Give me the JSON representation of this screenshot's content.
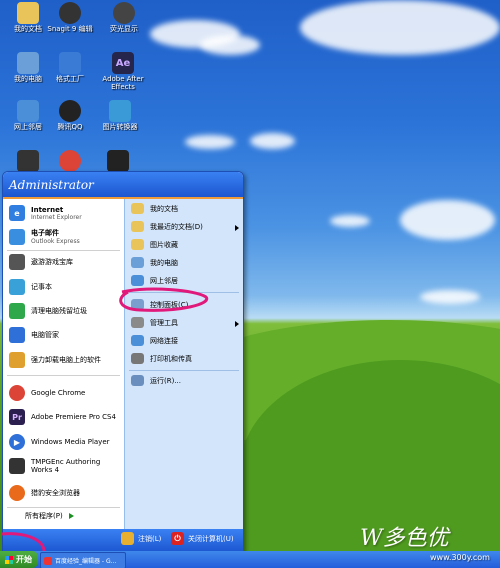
{
  "desktop_icons": [
    {
      "label": "我的文档",
      "icon": "my-documents-icon",
      "color": "#e8c45a",
      "glyph": ""
    },
    {
      "label": "Snagit 9 编辑",
      "icon": "snagit-icon",
      "color": "#333333",
      "glyph": ""
    },
    {
      "label": "荧光显示",
      "icon": "app-icon",
      "color": "#444444",
      "glyph": ""
    },
    {
      "label": "我的电脑",
      "icon": "my-computer-icon",
      "color": "#6a9fd8",
      "glyph": ""
    },
    {
      "label": "格式工厂",
      "icon": "format-factory-icon",
      "color": "#3a7bd5",
      "glyph": ""
    },
    {
      "label": "Adobe After Effects",
      "icon": "after-effects-icon",
      "color": "#26264c",
      "glyph": "Ae"
    },
    {
      "label": "网上邻居",
      "icon": "network-icon",
      "color": "#4a8fd8",
      "glyph": ""
    },
    {
      "label": "腾讯QQ",
      "icon": "qq-icon",
      "color": "#222222",
      "glyph": ""
    },
    {
      "label": "图片转换器",
      "icon": "image-converter-icon",
      "color": "#3a9ad8",
      "glyph": ""
    }
  ],
  "start_menu": {
    "user": "Administrator",
    "pinned": [
      {
        "title": "Internet",
        "sub": "Internet Explorer",
        "icon": "internet-explorer-icon",
        "color": "#2f7ee0",
        "glyph": "e"
      },
      {
        "title": "电子邮件",
        "sub": "Outlook Express",
        "icon": "outlook-express-icon",
        "color": "#3a8ee0",
        "glyph": ""
      }
    ],
    "recent": [
      {
        "label": "遨游游戏宝库",
        "icon": "game-library-icon",
        "color": "#555555",
        "glyph": ""
      },
      {
        "label": "记事本",
        "icon": "notepad-icon",
        "color": "#3aa0d8",
        "glyph": ""
      },
      {
        "label": "清理电脑残留垃圾",
        "icon": "cleaner-icon",
        "color": "#2fa84b",
        "glyph": ""
      },
      {
        "label": "电脑管家",
        "icon": "pc-manager-icon",
        "color": "#2f6fd8",
        "glyph": ""
      },
      {
        "label": "强力卸载电脑上的软件",
        "icon": "uninstaller-icon",
        "color": "#e0a030",
        "glyph": ""
      },
      {
        "label": "Google Chrome",
        "icon": "chrome-icon",
        "color": "#db4437",
        "glyph": ""
      },
      {
        "label": "Adobe Premiere Pro CS4",
        "icon": "premiere-icon",
        "color": "#2a1f4f",
        "glyph": "Pr"
      },
      {
        "label": "Windows Media Player",
        "icon": "media-player-icon",
        "color": "#2f6fd8",
        "glyph": "▶"
      },
      {
        "label": "TMPGEnc Authoring Works 4",
        "icon": "tmpgenc-icon",
        "color": "#333333",
        "glyph": ""
      },
      {
        "label": "猎豹安全浏览器",
        "icon": "liebao-browser-icon",
        "color": "#e86a1a",
        "glyph": ""
      }
    ],
    "all_programs": "所有程序(P)",
    "right_items": [
      {
        "label": "我的文档",
        "icon": "folder-icon",
        "color": "#e8c45a"
      },
      {
        "label": "我最近的文档(D)",
        "icon": "folder-icon",
        "color": "#e8c45a",
        "arrow": true
      },
      {
        "label": "图片收藏",
        "icon": "folder-icon",
        "color": "#e8c45a"
      },
      {
        "label": "我的电脑",
        "icon": "computer-icon",
        "color": "#6a9fd8"
      },
      {
        "label": "网上邻居",
        "icon": "network-icon",
        "color": "#4a8fd8"
      },
      {
        "label": "控制面板(C)",
        "icon": "control-panel-icon",
        "color": "#7a9fcf"
      },
      {
        "label": "管理工具",
        "icon": "admin-tools-icon",
        "color": "#8a8a8a",
        "arrow": true
      },
      {
        "label": "网络连接",
        "icon": "network-connections-icon",
        "color": "#4a8fd8"
      },
      {
        "label": "打印机和传真",
        "icon": "printer-icon",
        "color": "#777777"
      },
      {
        "label": "运行(R)...",
        "icon": "run-icon",
        "color": "#6a8fbf"
      }
    ],
    "logoff": "注销(L)",
    "shutdown": "关闭计算机(U)"
  },
  "taskbar": {
    "start": "开始",
    "task": "百度经验_编辑器 - G..."
  },
  "watermark": {
    "brand": "W多色优",
    "url": "www.300y.com"
  }
}
